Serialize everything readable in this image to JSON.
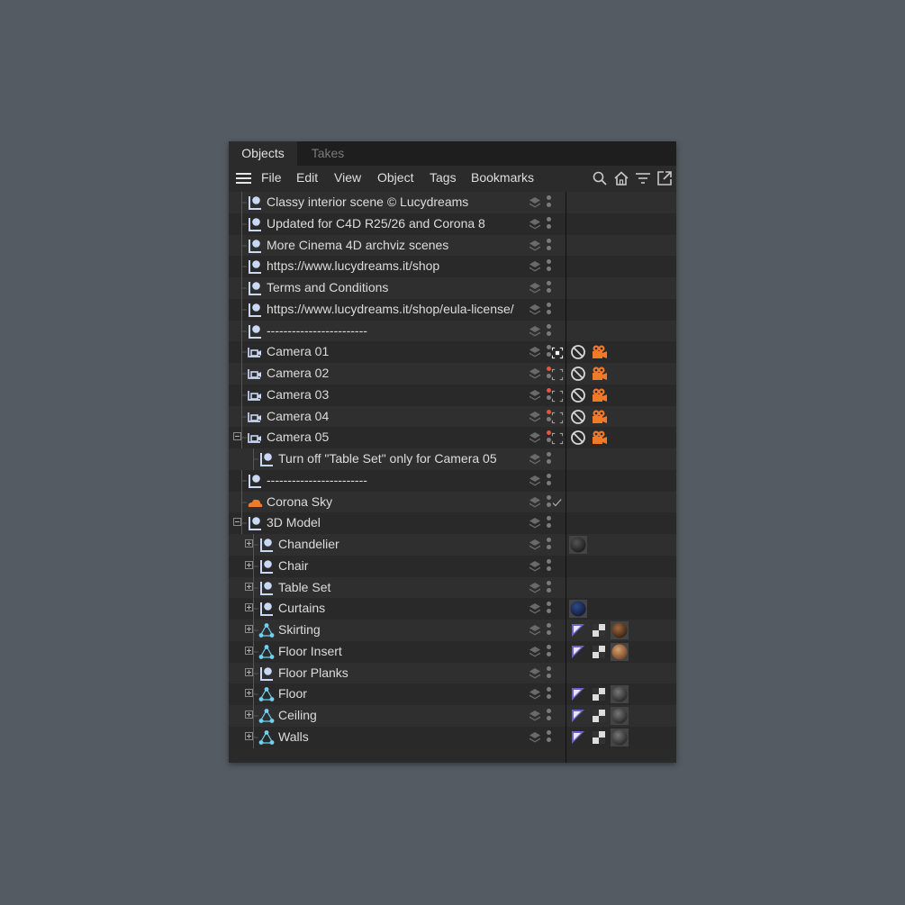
{
  "tabs": [
    {
      "label": "Objects",
      "active": true
    },
    {
      "label": "Takes",
      "active": false
    }
  ],
  "menu": [
    "File",
    "Edit",
    "View",
    "Object",
    "Tags",
    "Bookmarks"
  ],
  "toolbar_icons": [
    "search-icon",
    "home-icon",
    "filter-icon",
    "popout-icon"
  ],
  "rows": [
    {
      "label": "Classy interior scene © Lucydreams",
      "icon": "null-object-icon",
      "indent": 0
    },
    {
      "label": "Updated for C4D R25/26 and Corona 8",
      "icon": "null-object-icon",
      "indent": 0
    },
    {
      "label": "More Cinema 4D archviz scenes",
      "icon": "null-object-icon",
      "indent": 0
    },
    {
      "label": "https://www.lucydreams.it/shop",
      "icon": "null-object-icon",
      "indent": 0
    },
    {
      "label": "Terms and Conditions",
      "icon": "null-object-icon",
      "indent": 0
    },
    {
      "label": "https://www.lucydreams.it/shop/eula-license/",
      "icon": "null-object-icon",
      "indent": 0
    },
    {
      "label": "------------------------",
      "icon": "null-object-icon",
      "indent": 0
    },
    {
      "label": "Camera 01",
      "icon": "camera-icon",
      "indent": 0,
      "tags": [
        "camera-tag"
      ]
    },
    {
      "label": "Camera 02",
      "icon": "camera-icon",
      "indent": 0,
      "tags": [
        "camera-tag"
      ]
    },
    {
      "label": "Camera 03",
      "icon": "camera-icon",
      "indent": 0,
      "tags": [
        "camera-tag"
      ]
    },
    {
      "label": "Camera 04",
      "icon": "camera-icon",
      "indent": 0,
      "tags": [
        "camera-tag"
      ]
    },
    {
      "label": "Camera 05",
      "icon": "camera-icon",
      "indent": 0,
      "expanded": true,
      "tags": [
        "camera-tag"
      ]
    },
    {
      "label": "Turn off \"Table Set\" only for Camera 05",
      "icon": "null-object-icon",
      "indent": 1
    },
    {
      "label": "------------------------",
      "icon": "null-object-icon",
      "indent": 0
    },
    {
      "label": "Corona Sky",
      "icon": "corona-sky-icon",
      "indent": 0
    },
    {
      "label": "3D Model",
      "icon": "null-object-icon",
      "indent": 0,
      "expanded": true
    },
    {
      "label": "Chandelier",
      "icon": "null-object-icon",
      "indent": 1,
      "collapsed": true,
      "tags": [
        "material-dark"
      ]
    },
    {
      "label": "Chair",
      "icon": "null-object-icon",
      "indent": 1,
      "collapsed": true
    },
    {
      "label": "Table Set",
      "icon": "null-object-icon",
      "indent": 1,
      "collapsed": true
    },
    {
      "label": "Curtains",
      "icon": "null-object-icon",
      "indent": 1,
      "collapsed": true,
      "tags": [
        "material-blue"
      ]
    },
    {
      "label": "Skirting",
      "icon": "polygon-object-icon",
      "indent": 1,
      "collapsed": true,
      "tags": [
        "phong",
        "uvw",
        "material-wood"
      ]
    },
    {
      "label": "Floor Insert",
      "icon": "polygon-object-icon",
      "indent": 1,
      "collapsed": true,
      "tags": [
        "phong",
        "uvw",
        "material-tan"
      ]
    },
    {
      "label": "Floor Planks",
      "icon": "null-object-icon",
      "indent": 1,
      "collapsed": true
    },
    {
      "label": "Floor",
      "icon": "polygon-object-icon",
      "indent": 1,
      "collapsed": true,
      "tags": [
        "phong",
        "uvw",
        "material-grey"
      ]
    },
    {
      "label": "Ceiling",
      "icon": "polygon-object-icon",
      "indent": 1,
      "collapsed": true,
      "tags": [
        "phong",
        "uvw",
        "material-grey"
      ]
    },
    {
      "label": "Walls",
      "icon": "polygon-object-icon",
      "indent": 1,
      "collapsed": true,
      "tags": [
        "phong",
        "uvw",
        "material-grey"
      ]
    }
  ],
  "colors": {
    "accent_orange": "#f07a2a",
    "null_object": "#c9d8f5",
    "polygon_object": "#6fd0f0",
    "red_dot": "#e8523e"
  }
}
